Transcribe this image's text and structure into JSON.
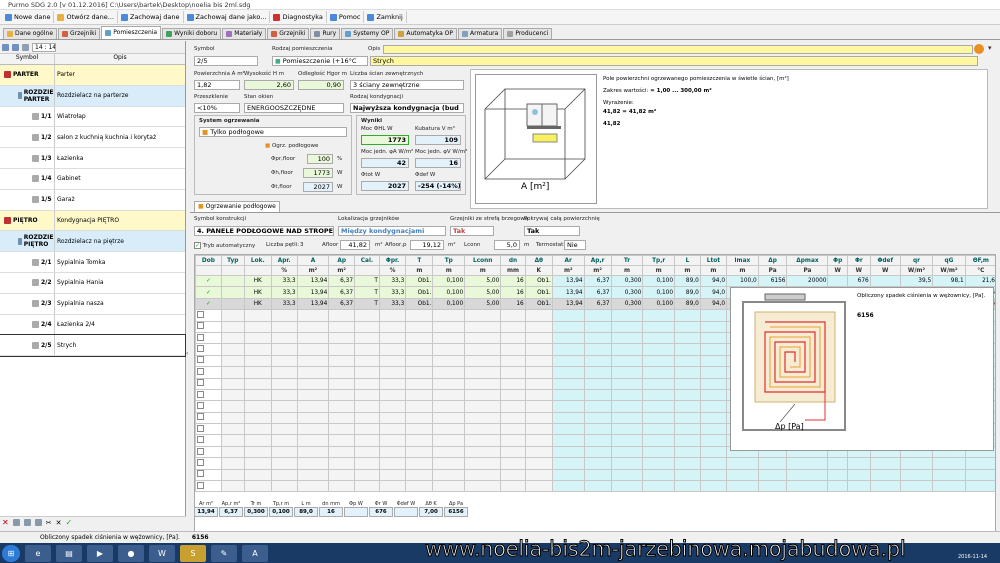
{
  "window": {
    "title": "Purmo SDG 2.0  [v 01.12.2016]  C:\\Users\\bartek\\Desktop\\noelia bis 2ml.sdg"
  },
  "menu": [
    {
      "label": "Nowe dane",
      "color": "#4a8ad8"
    },
    {
      "label": "Otwórz dane...",
      "color": "#e8b040"
    },
    {
      "label": "Zachowaj dane",
      "color": "#4a8ad8"
    },
    {
      "label": "Zachowaj dane jako...",
      "color": "#4a8ad8"
    },
    {
      "label": "Diagnostyka",
      "color": "#d03030"
    },
    {
      "label": "Pomoc",
      "color": "#4a8ad8"
    },
    {
      "label": "Zamknij",
      "color": "#4a8ad8"
    }
  ],
  "tabs": [
    "Dane ogólne",
    "Grzejniki",
    "Pomieszczenia",
    "Wyniki doboru",
    "Materiały",
    "Grzejniki",
    "Rury",
    "Systemy OP",
    "Automatyka OP",
    "Armatura",
    "Producenci"
  ],
  "left": {
    "counter": "14 : 14",
    "col_symbol": "Symbol",
    "col_opis": "Opis",
    "rows": [
      {
        "sym": "PARTER",
        "desc": "Parter",
        "level": 0,
        "bg": "#fff8c8"
      },
      {
        "sym": "ROZDZIE PARTER",
        "desc": "Rozdzielacz na parterze",
        "level": 1,
        "bg": "#d8ecfa"
      },
      {
        "sym": "1/1",
        "desc": "Wiatrołap",
        "level": 2,
        "bg": "#fff"
      },
      {
        "sym": "1/2",
        "desc": "salon z kuchnią kuchnia i korytaż",
        "level": 2,
        "bg": "#fff"
      },
      {
        "sym": "1/3",
        "desc": "Łazienka",
        "level": 2,
        "bg": "#fff"
      },
      {
        "sym": "1/4",
        "desc": "Gabinet",
        "level": 2,
        "bg": "#fff"
      },
      {
        "sym": "1/5",
        "desc": "Garaż",
        "level": 2,
        "bg": "#fff"
      },
      {
        "sym": "PIĘTRO",
        "desc": "Kondygnacja PIĘTRO",
        "level": 0,
        "bg": "#fff8c8"
      },
      {
        "sym": "ROZDZIE PIĘTRO",
        "desc": "Rozdzielacz na piętrze",
        "level": 1,
        "bg": "#d8ecfa"
      },
      {
        "sym": "2/1",
        "desc": "Sypialnia Tomka",
        "level": 2,
        "bg": "#fff"
      },
      {
        "sym": "2/2",
        "desc": "Sypialnia Hania",
        "level": 2,
        "bg": "#fff"
      },
      {
        "sym": "2/3",
        "desc": "Sypialnia nasza",
        "level": 2,
        "bg": "#fff"
      },
      {
        "sym": "2/4",
        "desc": "Łazienka 2/4",
        "level": 2,
        "bg": "#fff"
      },
      {
        "sym": "2/5",
        "desc": "Strych",
        "level": 2,
        "bg": "#fff"
      }
    ]
  },
  "form": {
    "symbol_lbl": "Symbol",
    "symbol": "2/5",
    "rodzaj_lbl": "Rodzaj pomieszczenia",
    "rodzaj": "Pomieszczenie (+16°C",
    "rodzaj_name": "Strych",
    "opis_lbl": "Opis",
    "pow_lbl": "Powierzchnia A m²",
    "pow": "1,82",
    "wys_lbl": "Wysokość H m",
    "wys": "2,60",
    "odl_lbl": "Odległość Hgor m",
    "odl": "0,90",
    "scian_lbl": "Liczba ścian zewnętrznych",
    "scian": "3 ściany zewnętrzne",
    "przesl_lbl": "Przeszklenie",
    "przesl": "<10%",
    "stan_lbl": "Stan okien",
    "stan": "ENERGOOSZCZĘDNE",
    "kond_lbl": "Rodzaj kondygnacji",
    "kond": "Najwyższa kondygnacja (bud",
    "system_lbl": "System ogrzewania",
    "system": "Tylko podłogowe",
    "ogrz_lbl": "Ogrz. podłogowe",
    "phi_pr_lbl": "Φpr,floor",
    "phi_pr": "100",
    "phi_pr_unit": "%",
    "phi_h_lbl": "Φh,floor",
    "phi_h": "1773",
    "phi_h_unit": "W",
    "phi_t_lbl": "Φt,floor",
    "phi_t": "2027",
    "phi_t_unit": "W",
    "wyniki_lbl": "Wyniki",
    "moc_lbl": "Moc ΦHL W",
    "moc": "1773",
    "kub_lbl": "Kubatura V m³",
    "kub": "109",
    "mj_lbl": "Moc jedn. φA W/m²",
    "mj": "42",
    "mjv_lbl": "Moc jedn. φV W/m³",
    "mjv": "16",
    "phitot_lbl": "Φtot W",
    "phitot": "2027",
    "phidef_lbl": "Φdef W",
    "phidef": "-254 (-14%)"
  },
  "info": {
    "line1": "Pole powierzchni ogrzewanego pomieszczenia w świetle ścian, [m²]",
    "line2": "Zakres wartości:",
    "line2b": "= 1,00 ... 300,00 m²",
    "line3": "Wyrażenie:",
    "line4": "41,82 = 41,82 m²",
    "line5": "41,82",
    "room_label": "A [m²]"
  },
  "subtab": "Ogrzewanie podłogowe",
  "construct": {
    "sys_lbl": "Symbol konstrukcji",
    "sys": "4. PANELE PODŁOGOWE NAD STROPEM",
    "lok_lbl": "Lokalizacja grzejników",
    "lok": "Między kondygnacjami",
    "grz_lbl": "Grzejniki ze strefą brzegową",
    "grz": "Tak",
    "pokr_lbl": "Pokrywaj całą powierzchnię",
    "pokr": "Tak",
    "tryb_lbl": "Tryb automatyczny",
    "petli_lbl": "Liczba pętli:",
    "petli": "3",
    "afloor_lbl": "Afloor",
    "afloor": "41,82",
    "m2a": "m²",
    "aflp_lbl": "Afloor,p",
    "aflp": "19,12",
    "m2b": "m²",
    "lconn_lbl": "Lconn",
    "lconn": "5,0",
    "mu": "m",
    "term_lbl": "Termostat:",
    "term": "Nie"
  },
  "grid": {
    "headers": [
      "Dob",
      "Typ",
      "Lok.",
      "Apr.",
      "A",
      "Ap",
      "Cal.",
      "Φpr.",
      "T",
      "Tp",
      "Lconn",
      "dn",
      "Δθ",
      "Ar",
      "Ap,r",
      "Tr",
      "Tp,r",
      "L",
      "Ltot",
      "lmax",
      "Δp",
      "Δpmax",
      "Φp",
      "Φr",
      "Φdef",
      "qr",
      "qG",
      "ΘF,m"
    ],
    "units": [
      "",
      "",
      "",
      "%",
      "m²",
      "m²",
      "",
      "%",
      "m",
      "m",
      "m",
      "mm",
      "K",
      "m²",
      "m²",
      "m",
      "m",
      "m",
      "m",
      "m",
      "Pa",
      "Pa",
      "W",
      "W",
      "W",
      "W/m²",
      "W/m²",
      "°C"
    ],
    "rows": [
      [
        "✓",
        "",
        "HK",
        "33,3",
        "13,94",
        "6,37",
        "T",
        "33,3",
        "Ob1.",
        "0,100",
        "5,00",
        "16",
        "Ob1.",
        "13,94",
        "6,37",
        "0,300",
        "0,100",
        "89,0",
        "94,0",
        "100,0",
        "6156",
        "20000",
        "",
        "676",
        "",
        "39,5",
        "98,1",
        "21,6"
      ],
      [
        "✓",
        "",
        "HK",
        "33,3",
        "13,94",
        "6,37",
        "T",
        "33,3",
        "Ob1.",
        "0,100",
        "5,00",
        "16",
        "Ob1.",
        "13,94",
        "6,37",
        "0,300",
        "0,100",
        "89,0",
        "94,0",
        "100,0",
        "6156",
        "20000",
        "",
        "676",
        "",
        "39,5",
        "98,1",
        "21,6"
      ],
      [
        "✓",
        "",
        "HK",
        "33,3",
        "13,94",
        "6,37",
        "T",
        "33,3",
        "Ob1.",
        "0,100",
        "5,00",
        "16",
        "Ob1.",
        "13,94",
        "6,37",
        "0,300",
        "0,100",
        "89,0",
        "94,0",
        "100,0",
        "6156",
        "20000",
        "",
        "676",
        "",
        "39,5",
        "98,1",
        "21,6"
      ]
    ],
    "empty_rows": 16
  },
  "tooltip": {
    "text": "Obliczony spadek ciśnienia w wężownicy, [Pa].",
    "value": "6156",
    "label": "Δp [Pa]"
  },
  "summary": {
    "headers": [
      "Ar m²",
      "Ap,r m²",
      "Tr m",
      "Tp,r m",
      "L m",
      "dn mm",
      "Φp W",
      "Φr W",
      "Φdef W",
      "Δθ K",
      "Δp Pa"
    ],
    "values": [
      "13,94",
      "6,37",
      "0,300",
      "0,100",
      "89,0",
      "16",
      "",
      "676",
      "",
      "7,00",
      "6156"
    ]
  },
  "status": {
    "text": "Obliczony spadek ciśnienia w wężownicy, [Pa].",
    "value": "6156"
  },
  "watermark": "www.noelia-bis2m-jarzebinowa.mojabudowa.pl",
  "clock": "2016-11-14"
}
